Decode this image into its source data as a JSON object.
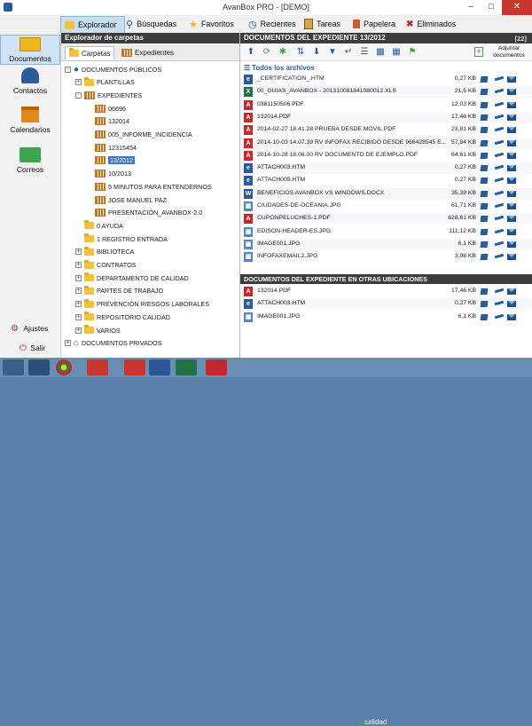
{
  "window": {
    "title": "AvanBox PRO - [DEMO]",
    "minimize": "–",
    "maximize": "□",
    "close": "✕"
  },
  "ribbon": {
    "tabs": [
      {
        "label": "Explorador",
        "active": true
      },
      {
        "label": "Búsquedas"
      },
      {
        "label": "Favoritos"
      },
      {
        "label": "Recientes"
      },
      {
        "label": "Tareas"
      },
      {
        "label": "Papelera"
      },
      {
        "label": "Eliminados"
      }
    ]
  },
  "sidebar": {
    "items": [
      {
        "label": "Documentos",
        "active": true
      },
      {
        "label": "Contactos"
      },
      {
        "label": "Calendarios"
      },
      {
        "label": "Correos"
      }
    ],
    "bottom": [
      {
        "label": "Ajustes"
      },
      {
        "label": "Salir"
      }
    ]
  },
  "tree": {
    "header": "Explorador de carpetas",
    "subtabs": [
      {
        "label": "Carpetas",
        "active": true
      },
      {
        "label": "Expedientes"
      }
    ],
    "nodes": [
      {
        "label": "DOCUMENTOS PÚBLICOS",
        "level": 0,
        "icon": "globe",
        "pm": "-"
      },
      {
        "label": "PLANTILLAS",
        "level": 1,
        "icon": "folder",
        "pm": "+"
      },
      {
        "label": "EXPEDIENTES",
        "level": 1,
        "icon": "expedientes",
        "pm": "-"
      },
      {
        "label": "06696",
        "level": 2,
        "icon": "expediente"
      },
      {
        "label": "132014",
        "level": 2,
        "icon": "expediente"
      },
      {
        "label": "005_INFORME_INCIDENCIA",
        "level": 2,
        "icon": "expediente"
      },
      {
        "label": "12315454",
        "level": 2,
        "icon": "expediente"
      },
      {
        "label": "13/2012",
        "level": 2,
        "icon": "expediente",
        "selected": true
      },
      {
        "label": "10/2013",
        "level": 2,
        "icon": "expediente"
      },
      {
        "label": "5 MINUTOS PARA ENTENDERNOS",
        "level": 2,
        "icon": "expediente"
      },
      {
        "label": "JOSE MANUEL PAZ",
        "level": 2,
        "icon": "expediente"
      },
      {
        "label": "PRESENTACIÓN_AVANBOX-2.0",
        "level": 2,
        "icon": "expediente"
      },
      {
        "label": "0 AYUDA",
        "level": 1,
        "icon": "folder"
      },
      {
        "label": "1 REGISTRO ENTRADA",
        "level": 1,
        "icon": "folder"
      },
      {
        "label": "BIBLIOTECA",
        "level": 1,
        "icon": "folder",
        "pm": "+"
      },
      {
        "label": "CONTRATOS",
        "level": 1,
        "icon": "folder",
        "pm": "+"
      },
      {
        "label": "DEPARTAMENTO DE CALIDAD",
        "level": 1,
        "icon": "folder",
        "pm": "+"
      },
      {
        "label": "PARTES DE TRABAJO",
        "level": 1,
        "icon": "folder",
        "pm": "+"
      },
      {
        "label": "PREVENCIÓN RIESGOS LABORALES",
        "level": 1,
        "icon": "folder",
        "pm": "+"
      },
      {
        "label": "REPOSITORIO CALIDAD",
        "level": 1,
        "icon": "folder",
        "pm": "+"
      },
      {
        "label": "VARIOS",
        "level": 1,
        "icon": "folder",
        "pm": "+"
      },
      {
        "label": "DOCUMENTOS PRIVADOS",
        "level": 0,
        "icon": "house",
        "pm": "+"
      }
    ]
  },
  "main": {
    "header": "DOCUMENTOS DEL EXPEDIENTE 13/2012",
    "counter": "[22]",
    "add_label": "Adjuntar documentos",
    "all_files_label": "Todos los archivos",
    "files": [
      {
        "name": "_CERTIFICATION_.HTM",
        "size": "0,27 KB",
        "type": "htm"
      },
      {
        "name": "00_GUIAS_AVANBOX - 201310081841080012.XLS",
        "size": "21,5 KB",
        "type": "xls"
      },
      {
        "name": "0381150506.PDF",
        "size": "12,03 KB",
        "type": "pdf"
      },
      {
        "name": "132014.PDF",
        "size": "17,46 KB",
        "type": "pdf"
      },
      {
        "name": "2014-02-27 18.41.28 PRUEBA DESDE MOVIL.PDF",
        "size": "23,81 KB",
        "type": "pdf"
      },
      {
        "name": "2014-10-03 14.07.39 RV INFOFAX RECIBIDO DESDE 966428545 E...",
        "size": "57,84 KB",
        "type": "pdf"
      },
      {
        "name": "2014-10-28 18.06.00 RV DOCUMENTO DE EJEMPLO.PDF",
        "size": "64,61 KB",
        "type": "pdf"
      },
      {
        "name": "ATTACH003.HTM",
        "size": "0,27 KB",
        "type": "htm"
      },
      {
        "name": "ATTACH005.HTM",
        "size": "0,27 KB",
        "type": "htm"
      },
      {
        "name": "BENEFICIOS AVANBOX VS WINDOWS.DOCX",
        "size": "35,38 KB",
        "type": "doc"
      },
      {
        "name": "CIUDADES-DE-OCEANIA.JPG",
        "size": "61,71 KB",
        "type": "jpg"
      },
      {
        "name": "CUPONPELUCHES-1.PDF",
        "size": "628,61 KB",
        "type": "pdf"
      },
      {
        "name": "EDISON-HEADER-ES.JPG",
        "size": "111,12 KB",
        "type": "jpg"
      },
      {
        "name": "IMAGE001.JPG",
        "size": "6,1 KB",
        "type": "jpg"
      },
      {
        "name": "INFOFAXEMAIL2.JPG",
        "size": "3,98 KB",
        "type": "jpg"
      }
    ],
    "other_header": "DOCUMENTOS DEL EXPEDIENTE EN OTRAS UBICACIONES",
    "other_files": [
      {
        "name": "132014.PDF",
        "size": "17,46 KB",
        "type": "pdf"
      },
      {
        "name": "ATTACH003.HTM",
        "size": "0,27 KB",
        "type": "htm"
      },
      {
        "name": "IMAGE001.JPG",
        "size": "6,1 KB",
        "type": "jpg"
      }
    ]
  },
  "taskbar": {
    "user_label": "calidad"
  }
}
